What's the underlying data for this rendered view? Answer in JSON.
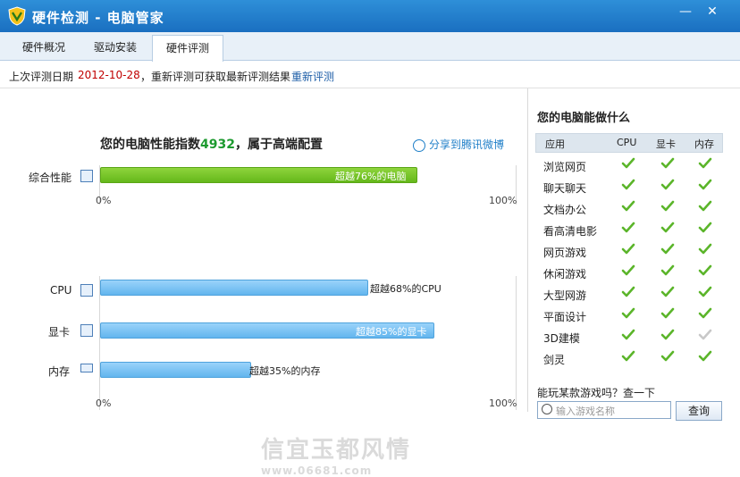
{
  "window": {
    "title": "硬件检测 - 电脑管家",
    "minimize_glyph": "—",
    "close_glyph": "✕"
  },
  "tabs": [
    {
      "label": "硬件概况"
    },
    {
      "label": "驱动安装"
    },
    {
      "label": "硬件评测"
    }
  ],
  "info": {
    "prefix": "上次评测日期",
    "date": "2012-10-28",
    "suffix": "，重新评测可获取最新评测结果",
    "rerun_link": "重新评测"
  },
  "headline": {
    "text_before": "您的电脑性能指数",
    "score": "4932",
    "text_after": "，属于高端配置"
  },
  "share_label": "分享到腾讯微博",
  "overall": {
    "label": "综合性能",
    "bar_text": "超越76%的电脑",
    "percent": 76,
    "axis_min": "0%",
    "axis_max": "100%"
  },
  "components": [
    {
      "label": "CPU",
      "bar_text": "超越68%的CPU",
      "percent": 64
    },
    {
      "label": "显卡",
      "bar_text": "超越85%的显卡",
      "percent": 80
    },
    {
      "label": "内存",
      "bar_text": "超越35%的内存",
      "percent": 36
    }
  ],
  "components_axis": {
    "min": "0%",
    "max": "100%"
  },
  "capabilities": {
    "title": "您的电脑能做什么",
    "headers": [
      "应用",
      "CPU",
      "显卡",
      "内存"
    ],
    "rows": [
      {
        "app": "浏览网页",
        "cpu": true,
        "gpu": true,
        "mem": true
      },
      {
        "app": "聊天聊天",
        "cpu": true,
        "gpu": true,
        "mem": true
      },
      {
        "app": "文档办公",
        "cpu": true,
        "gpu": true,
        "mem": true
      },
      {
        "app": "看高清电影",
        "cpu": true,
        "gpu": true,
        "mem": true
      },
      {
        "app": "网页游戏",
        "cpu": true,
        "gpu": true,
        "mem": true
      },
      {
        "app": "休闲游戏",
        "cpu": true,
        "gpu": true,
        "mem": true
      },
      {
        "app": "大型网游",
        "cpu": true,
        "gpu": true,
        "mem": true
      },
      {
        "app": "平面设计",
        "cpu": true,
        "gpu": true,
        "mem": true
      },
      {
        "app": "3D建模",
        "cpu": true,
        "gpu": true,
        "mem": false
      },
      {
        "app": "剑灵",
        "cpu": true,
        "gpu": true,
        "mem": true
      }
    ],
    "check_color": "#5bb52a",
    "disabled_check_color": "#c8c8c8"
  },
  "game_query": {
    "question": "能玩某款游戏吗？查一下",
    "placeholder": "输入游戏名称",
    "button": "查询"
  },
  "watermark": {
    "main": "信宜玉都风情",
    "sub": "www.06681.com"
  }
}
